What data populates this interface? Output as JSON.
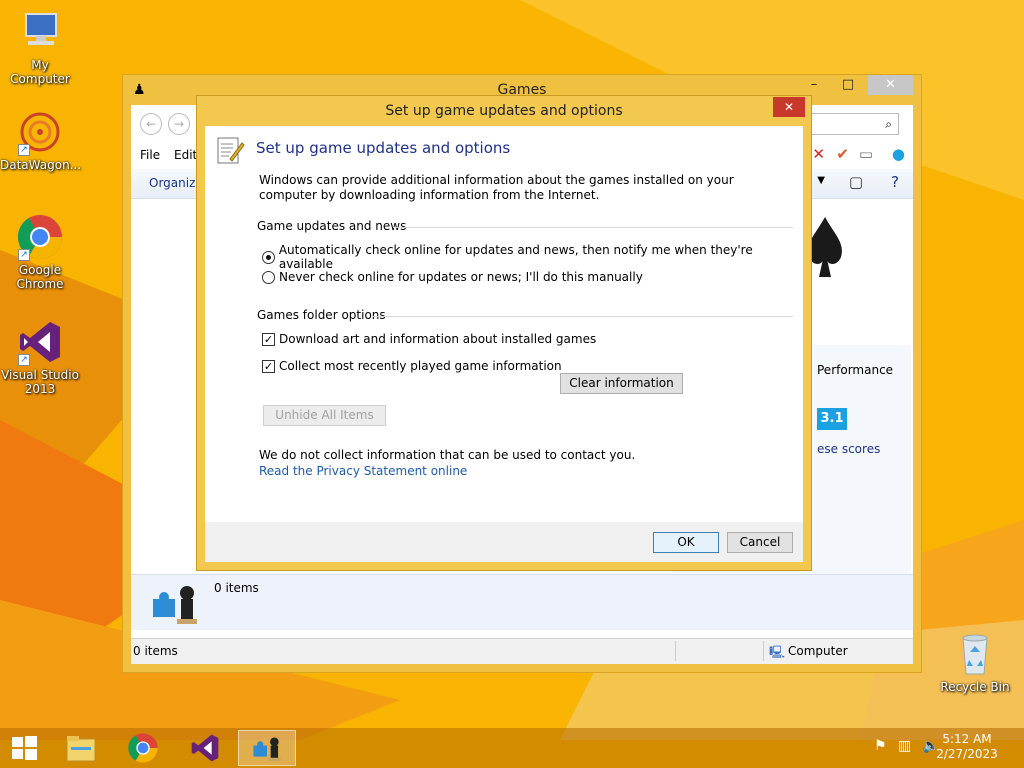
{
  "desktop": {
    "icons": [
      {
        "label": "My Computer",
        "icon": "computer-icon"
      },
      {
        "label": "DataWagon...",
        "icon": "datawagon-icon"
      },
      {
        "label": "Google Chrome",
        "icon": "chrome-icon"
      },
      {
        "label": "Visual Studio 2013",
        "icon": "visual-studio-icon"
      },
      {
        "label": "Recycle Bin",
        "icon": "recycle-bin-icon"
      }
    ]
  },
  "games_window": {
    "title": "Games",
    "menu": [
      "File",
      "Edit"
    ],
    "toolbar_organize": "Organize",
    "performance_label": "Performance",
    "score": "3.1",
    "scores_link": "ese scores",
    "details_count": "0 items",
    "status_left": "0 items",
    "status_right": "Computer",
    "controls": {
      "minimize": "–",
      "maximize": "□",
      "close": "✕"
    }
  },
  "dialog": {
    "title": "Set up game updates and options",
    "heading": "Set up game updates and options",
    "description": "Windows can provide additional information about the games installed on your computer by downloading information from the Internet.",
    "updates_group": "Game updates and news",
    "radio_auto": "Automatically check online for updates and news, then notify me when they're available",
    "radio_never": "Never check online for updates or news; I'll do this manually",
    "radio_selected": "auto",
    "folder_group": "Games folder options",
    "check_download": "Download art and information about installed games",
    "check_download_checked": true,
    "check_collect": "Collect most recently played game information",
    "check_collect_checked": true,
    "clear_button": "Clear information",
    "unhide_button": "Unhide All Items",
    "privacy_note": "We do not collect information that can be used to contact you.",
    "privacy_link": "Read the Privacy Statement online",
    "ok_button": "OK",
    "cancel_button": "Cancel",
    "close_glyph": "✕"
  },
  "taskbar": {
    "apps": [
      "file-explorer-icon",
      "chrome-icon",
      "visual-studio-icon",
      "games-icon"
    ],
    "time": "5:12 AM",
    "date": "2/27/2023"
  }
}
